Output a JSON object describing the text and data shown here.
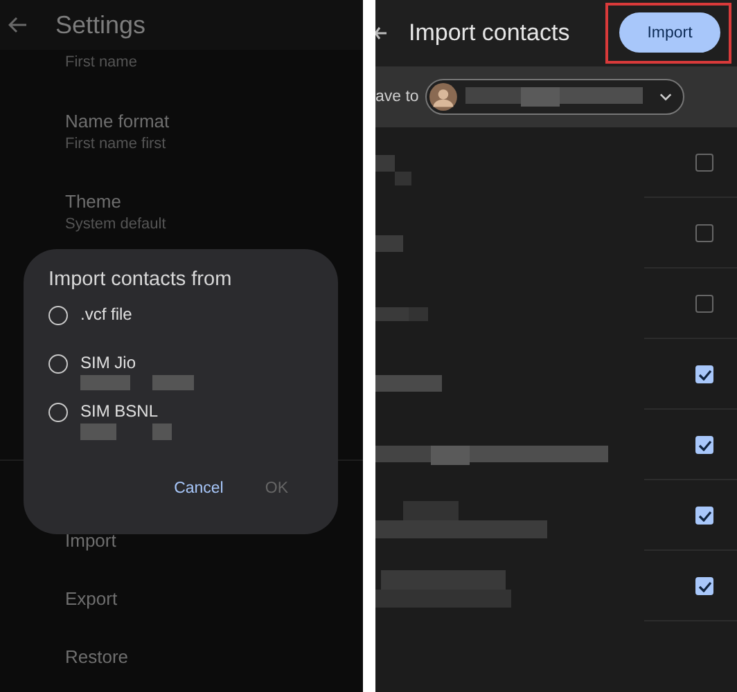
{
  "settings_screen": {
    "title": "Settings",
    "items": [
      {
        "subtitle": "First name"
      },
      {
        "title": "Name format",
        "subtitle": "First name first"
      },
      {
        "title": "Theme",
        "subtitle": "System default"
      }
    ],
    "lower_items": [
      {
        "title": "Import"
      },
      {
        "title": "Export"
      },
      {
        "title": "Restore"
      }
    ],
    "dialog": {
      "title": "Import contacts from",
      "options": [
        {
          "label": ".vcf file",
          "selected": false,
          "redacted_detail": false
        },
        {
          "label": "SIM Jio",
          "selected": false,
          "redacted_detail": true
        },
        {
          "label": "SIM BSNL",
          "selected": false,
          "redacted_detail": true
        }
      ],
      "buttons": [
        {
          "label": "Cancel",
          "disabled": false
        },
        {
          "label": "OK",
          "disabled": true
        }
      ]
    }
  },
  "import_screen": {
    "title": "Import contacts",
    "import_button": "Import",
    "save_to_label": "ave to",
    "contacts": [
      {
        "checked": false
      },
      {
        "checked": false
      },
      {
        "checked": false
      },
      {
        "checked": true
      },
      {
        "checked": true
      },
      {
        "checked": true
      },
      {
        "checked": true
      }
    ]
  }
}
